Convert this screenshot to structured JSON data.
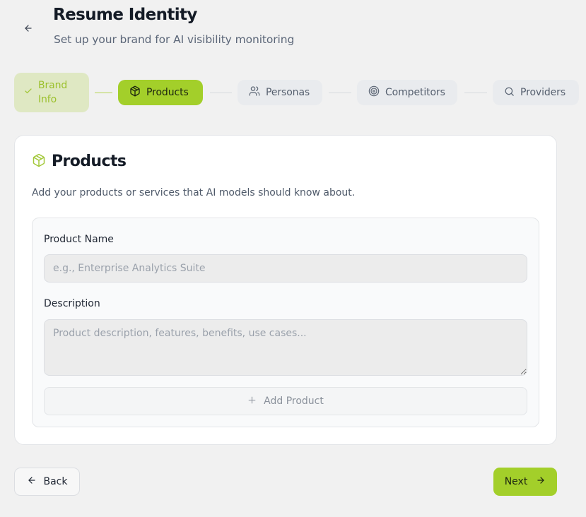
{
  "header": {
    "title": "Resume Identity",
    "subtitle": "Set up your brand for AI visibility monitoring"
  },
  "stepper": {
    "steps": [
      {
        "label": "Brand\nInfo",
        "state": "completed",
        "icon": "check-icon"
      },
      {
        "label": "Products",
        "state": "active",
        "icon": "package-icon"
      },
      {
        "label": "Personas",
        "state": "pending",
        "icon": "users-icon"
      },
      {
        "label": "Competitors",
        "state": "pending",
        "icon": "target-icon"
      },
      {
        "label": "Providers",
        "state": "pending",
        "icon": "search-icon"
      }
    ]
  },
  "card": {
    "title": "Products",
    "icon": "package-icon",
    "description": "Add your products or services that AI models should know about.",
    "form": {
      "product_name_label": "Product Name",
      "product_name_placeholder": "e.g., Enterprise Analytics Suite",
      "product_name_value": "",
      "description_label": "Description",
      "description_placeholder": "Product description, features, benefits, use cases...",
      "description_value": "",
      "add_button_label": "Add Product"
    }
  },
  "footer": {
    "back_label": "Back",
    "next_label": "Next"
  },
  "colors": {
    "accent": "#a3cf2a",
    "accent_soft": "#dfe8c3",
    "background": "#f1f1f1"
  }
}
